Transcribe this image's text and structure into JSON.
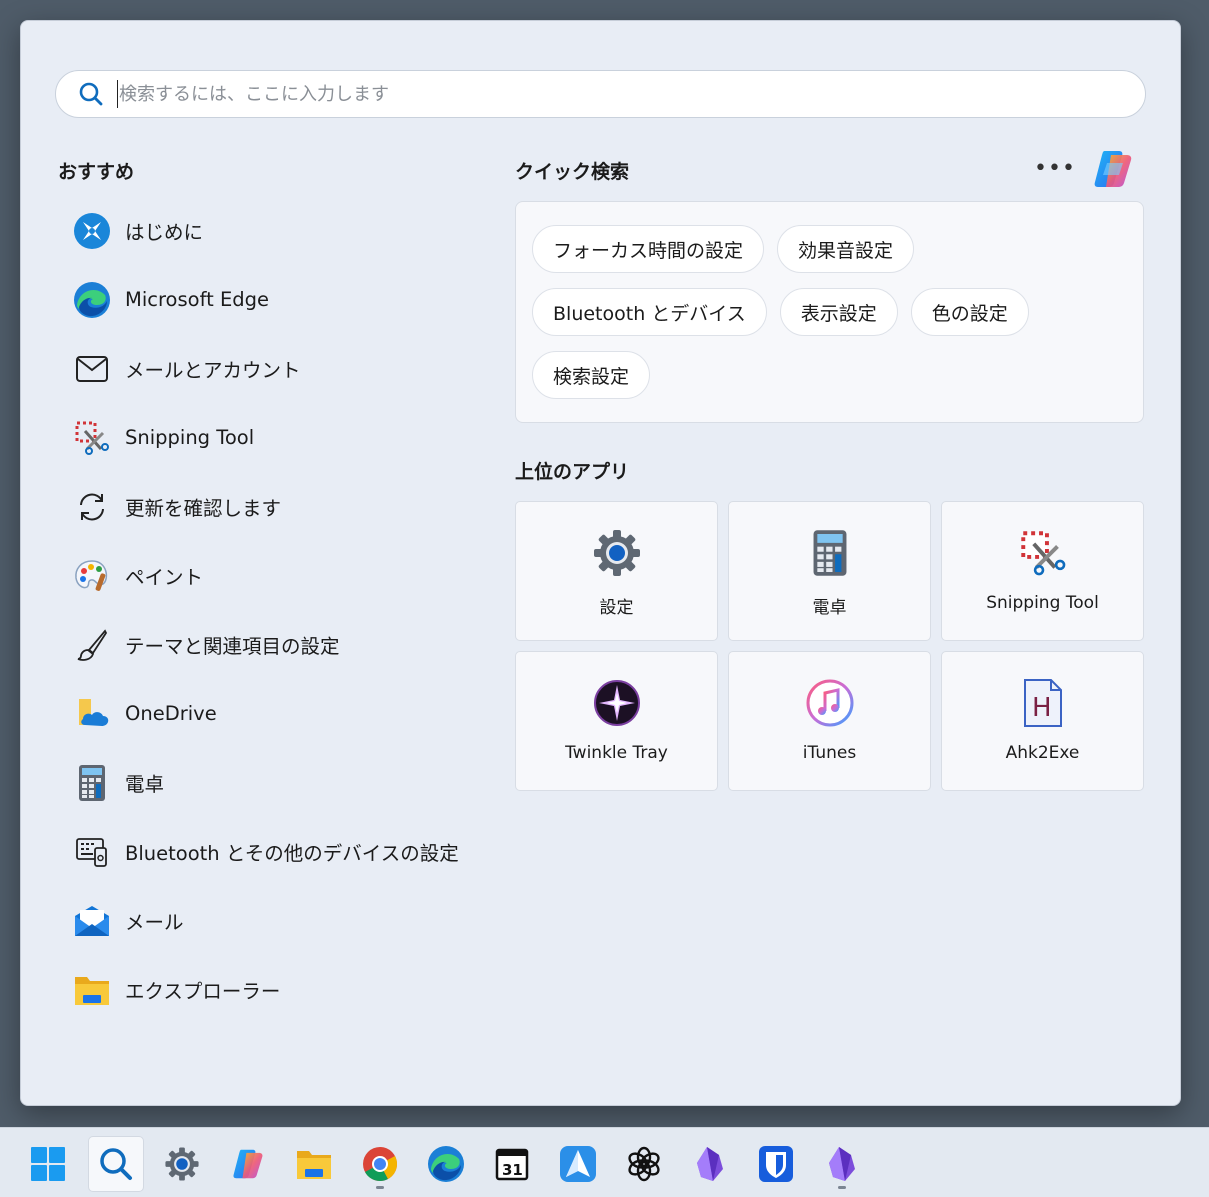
{
  "search": {
    "placeholder": "検索するには、ここに入力します"
  },
  "recommended": {
    "title": "おすすめ",
    "items": [
      {
        "label": "はじめに",
        "icon": "get-started-icon"
      },
      {
        "label": "Microsoft Edge",
        "icon": "edge-icon"
      },
      {
        "label": "メールとアカウント",
        "icon": "mail-outline-icon"
      },
      {
        "label": "Snipping Tool",
        "icon": "snipping-tool-icon"
      },
      {
        "label": "更新を確認します",
        "icon": "refresh-icon"
      },
      {
        "label": "ペイント",
        "icon": "paint-icon"
      },
      {
        "label": "テーマと関連項目の設定",
        "icon": "brush-icon"
      },
      {
        "label": "OneDrive",
        "icon": "onedrive-icon"
      },
      {
        "label": "電卓",
        "icon": "calculator-icon"
      },
      {
        "label": "Bluetooth とその他のデバイスの設定",
        "icon": "devices-icon"
      },
      {
        "label": "メール",
        "icon": "mail-app-icon"
      },
      {
        "label": "エクスプローラー",
        "icon": "folder-icon"
      }
    ]
  },
  "quick_search": {
    "title": "クイック検索",
    "more_label": "•••",
    "chips": [
      [
        "フォーカス時間の設定",
        "効果音設定"
      ],
      [
        "Bluetooth とデバイス",
        "表示設定",
        "色の設定"
      ],
      [
        "検索設定"
      ]
    ]
  },
  "top_apps": {
    "title": "上位のアプリ",
    "apps": [
      {
        "label": "設定",
        "icon": "settings-gear-icon"
      },
      {
        "label": "電卓",
        "icon": "calculator-icon"
      },
      {
        "label": "Snipping Tool",
        "icon": "snipping-tool-icon"
      },
      {
        "label": "Twinkle Tray",
        "icon": "twinkle-tray-icon"
      },
      {
        "label": "iTunes",
        "icon": "itunes-icon"
      },
      {
        "label": "Ahk2Exe",
        "icon": "ahk2exe-icon"
      }
    ]
  },
  "calendar_day": "31",
  "ahk_letter": "H",
  "taskbar": {
    "icons": [
      "windows-start-icon",
      "search-icon",
      "settings-icon",
      "copilot-icon",
      "file-explorer-icon",
      "chrome-icon",
      "edge-icon",
      "calendar-icon",
      "send-icon",
      "chatgpt-icon",
      "obsidian-icon",
      "bitwarden-icon",
      "obsidian-icon"
    ]
  },
  "colors": {
    "accent": "#0067c0",
    "panel": "#e8edf5",
    "taskbar": "#e3e9f1"
  }
}
